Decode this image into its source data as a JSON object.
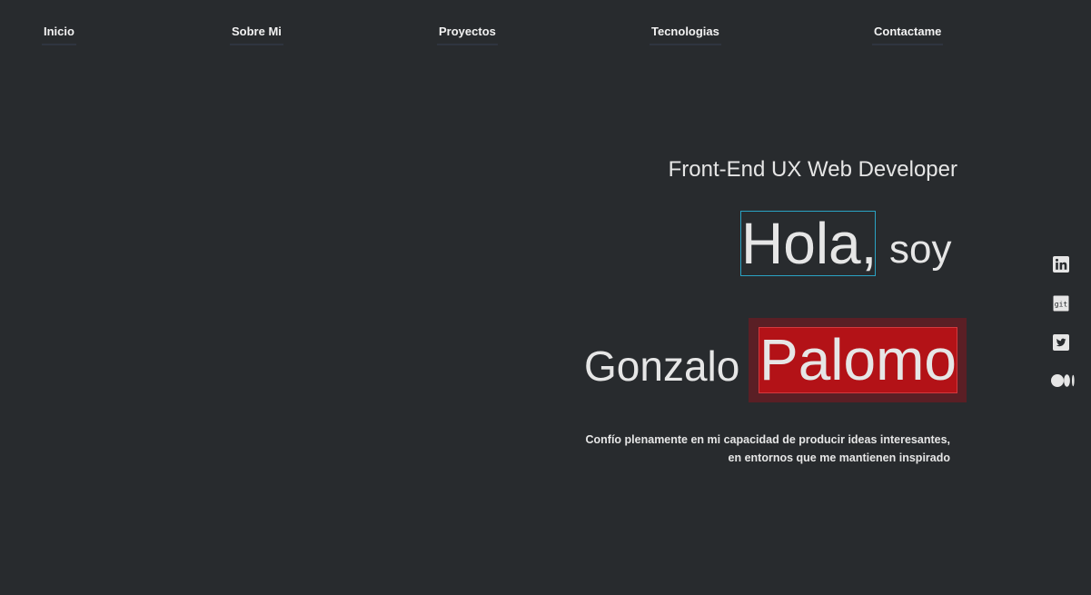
{
  "nav": {
    "items": [
      {
        "label": "Inicio"
      },
      {
        "label": "Sobre Mi"
      },
      {
        "label": "Proyectos"
      },
      {
        "label": "Tecnologias"
      },
      {
        "label": "Contactame"
      }
    ]
  },
  "hero": {
    "subtitle": "Front-End UX Web Developer",
    "greeting": "Hola,",
    "greeting_rest": "soy",
    "first_name": "Gonzalo",
    "last_name": "Palomo",
    "description": "Confío plenamente en mi capacidad de producir ideas interesantes, en entornos que me mantienen inspirado"
  },
  "social": {
    "items": [
      {
        "icon": "linkedin-icon"
      },
      {
        "icon": "git-icon",
        "label": "git"
      },
      {
        "icon": "twitter-icon"
      },
      {
        "icon": "medium-icon"
      }
    ]
  },
  "colors": {
    "background": "#282b2e",
    "accent_red": "#b31217",
    "accent_blue": "#2aa3c4",
    "text": "#e6e6e6"
  }
}
